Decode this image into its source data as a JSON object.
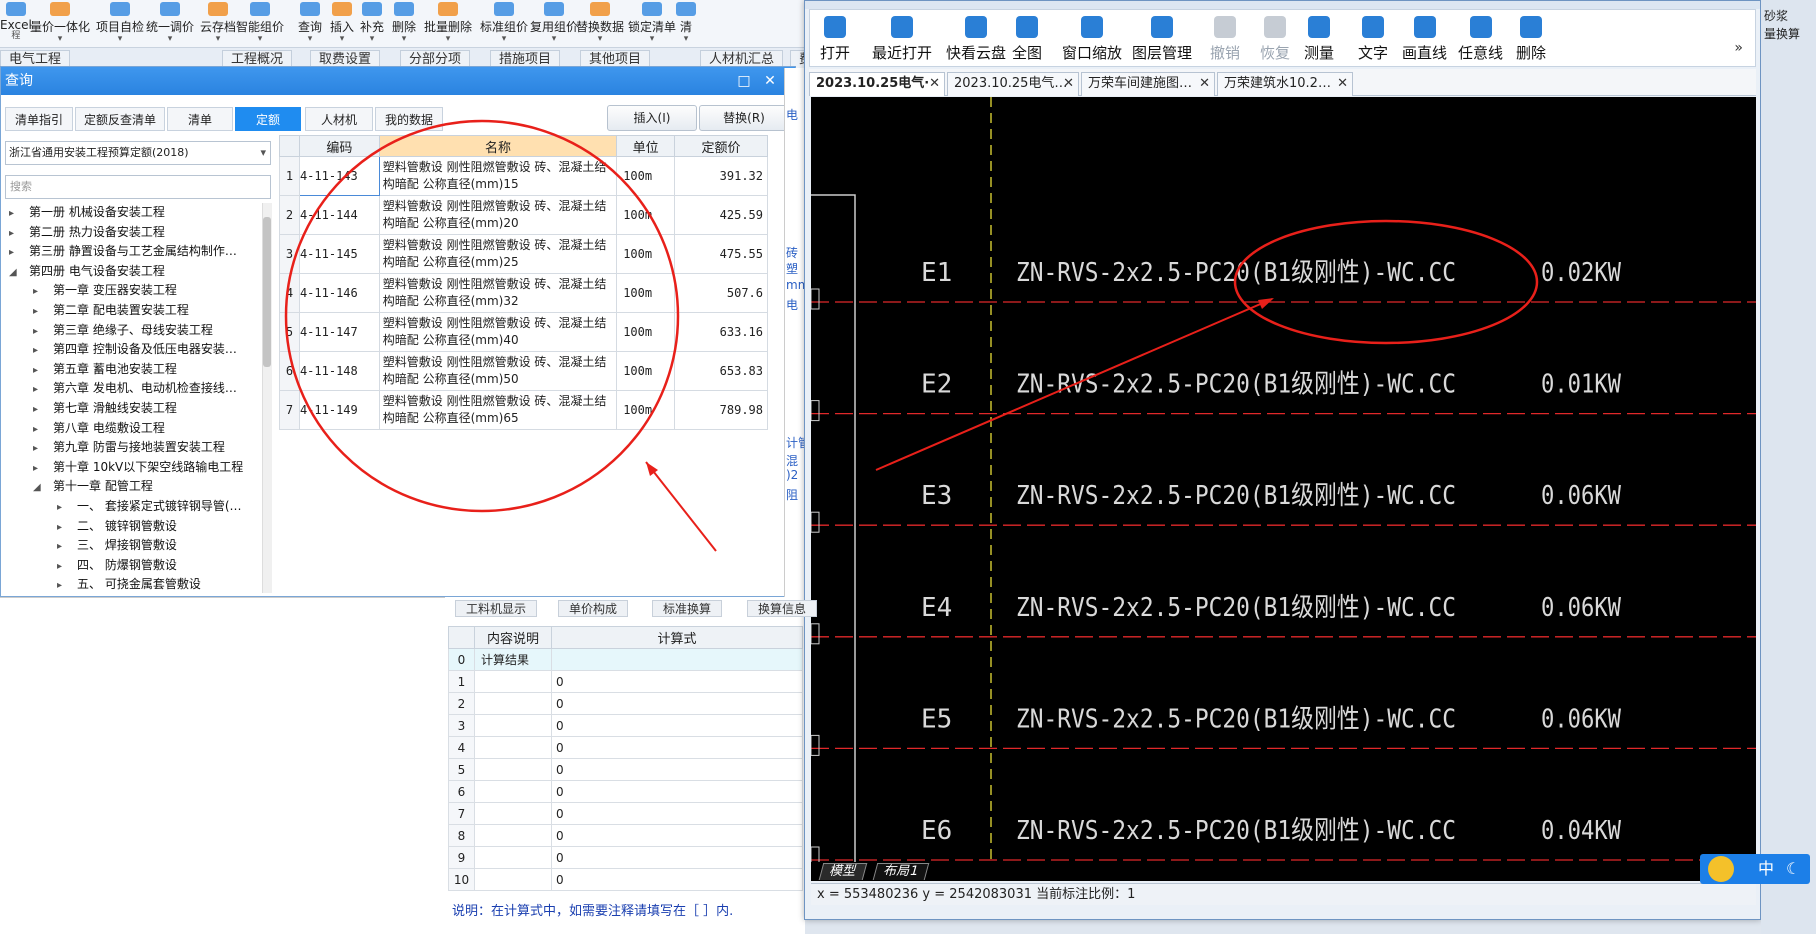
{
  "top_toolbar": {
    "items": [
      {
        "label": "Excel",
        "sub": "程",
        "icon": "excel-icon"
      },
      {
        "label": "量价一体化",
        "icon": "price-icon"
      },
      {
        "label": "项目自检",
        "icon": "check-icon"
      },
      {
        "label": "统一调价",
        "icon": "adjust-icon"
      },
      {
        "label": "云存档",
        "icon": "cloud-icon"
      },
      {
        "label": "智能组价",
        "icon": "smart-icon"
      },
      {
        "label": "查询",
        "icon": "search-icon"
      },
      {
        "label": "插入",
        "icon": "insert-icon"
      },
      {
        "label": "补充",
        "icon": "add-icon"
      },
      {
        "label": "删除",
        "icon": "delete-icon"
      },
      {
        "label": "批量删除",
        "icon": "batch-delete-icon"
      },
      {
        "label": "标准组价",
        "icon": "standard-icon"
      },
      {
        "label": "复用组价",
        "icon": "reuse-icon"
      },
      {
        "label": "替换数据",
        "icon": "replace-icon"
      },
      {
        "label": "锁定清单",
        "icon": "lock-icon"
      },
      {
        "label": "清",
        "icon": "clear-icon"
      }
    ],
    "right_labels": [
      "砂浆",
      "量换算"
    ]
  },
  "page_tabs": [
    "电气工程",
    "工程概况",
    "取费设置",
    "分部分项",
    "措施项目",
    "其他项目",
    "人材机汇总",
    "费"
  ],
  "query": {
    "title": "查询",
    "tabs": [
      "清单指引",
      "定额反查清单",
      "清单",
      "定额",
      "人材机",
      "我的数据"
    ],
    "active_tab": "定额",
    "insert_label": "插入(I)",
    "replace_label": "替换(R)",
    "library": "浙江省通用安装工程预算定额(2018)",
    "search_placeholder": "搜索",
    "tree": [
      {
        "label": "第一册 机械设备安装工程",
        "level": 0,
        "arrow": "▸"
      },
      {
        "label": "第二册 热力设备安装工程",
        "level": 0,
        "arrow": "▸"
      },
      {
        "label": "第三册 静置设备与工艺金属结构制作…",
        "level": 0,
        "arrow": "▸"
      },
      {
        "label": "第四册 电气设备安装工程",
        "level": 0,
        "arrow": "◢"
      },
      {
        "label": "第一章 变压器安装工程",
        "level": 1,
        "arrow": "▸"
      },
      {
        "label": "第二章 配电装置安装工程",
        "level": 1,
        "arrow": "▸"
      },
      {
        "label": "第三章 绝缘子、母线安装工程",
        "level": 1,
        "arrow": "▸"
      },
      {
        "label": "第四章 控制设备及低压电器安装…",
        "level": 1,
        "arrow": "▸"
      },
      {
        "label": "第五章 蓄电池安装工程",
        "level": 1,
        "arrow": "▸"
      },
      {
        "label": "第六章 发电机、电动机检查接线…",
        "level": 1,
        "arrow": "▸"
      },
      {
        "label": "第七章 滑触线安装工程",
        "level": 1,
        "arrow": "▸"
      },
      {
        "label": "第八章 电缆敷设工程",
        "level": 1,
        "arrow": "▸"
      },
      {
        "label": "第九章 防雷与接地装置安装工程",
        "level": 1,
        "arrow": "▸"
      },
      {
        "label": "第十章 10kV以下架空线路输电工程",
        "level": 1,
        "arrow": "▸"
      },
      {
        "label": "第十一章 配管工程",
        "level": 1,
        "arrow": "◢"
      },
      {
        "label": "一、 套接紧定式镀锌钢导管(…",
        "level": 2,
        "arrow": "▸"
      },
      {
        "label": "二、 镀锌钢管敷设",
        "level": 2,
        "arrow": "▸"
      },
      {
        "label": "三、 焊接钢管敷设",
        "level": 2,
        "arrow": "▸"
      },
      {
        "label": "四、 防爆钢管敷设",
        "level": 2,
        "arrow": "▸"
      },
      {
        "label": "五、 可挠金属套管敷设",
        "level": 2,
        "arrow": "▸"
      }
    ],
    "table": {
      "headers": [
        "编码",
        "名称",
        "单位",
        "定额价"
      ],
      "rows": [
        {
          "n": "1",
          "code": "4-11-143",
          "name": "塑料管敷设 刚性阻燃管敷设 砖、混凝土结构暗配 公称直径(mm)15",
          "unit": "100m",
          "price": "391.32"
        },
        {
          "n": "2",
          "code": "4-11-144",
          "name": "塑料管敷设 刚性阻燃管敷设 砖、混凝土结构暗配 公称直径(mm)20",
          "unit": "100m",
          "price": "425.59"
        },
        {
          "n": "3",
          "code": "4-11-145",
          "name": "塑料管敷设 刚性阻燃管敷设 砖、混凝土结构暗配 公称直径(mm)25",
          "unit": "100m",
          "price": "475.55"
        },
        {
          "n": "4",
          "code": "4-11-146",
          "name": "塑料管敷设 刚性阻燃管敷设 砖、混凝土结构暗配 公称直径(mm)32",
          "unit": "100m",
          "price": "507.6"
        },
        {
          "n": "5",
          "code": "4-11-147",
          "name": "塑料管敷设 刚性阻燃管敷设 砖、混凝土结构暗配 公称直径(mm)40",
          "unit": "100m",
          "price": "633.16"
        },
        {
          "n": "6",
          "code": "4-11-148",
          "name": "塑料管敷设 刚性阻燃管敷设 砖、混凝土结构暗配 公称直径(mm)50",
          "unit": "100m",
          "price": "653.83"
        },
        {
          "n": "7",
          "code": "4-11-149",
          "name": "塑料管敷设 刚性阻燃管敷设 砖、混凝土结构暗配 公称直径(mm)65",
          "unit": "100m",
          "price": "789.98"
        }
      ]
    }
  },
  "calc": {
    "tabs": [
      "工料机显示",
      "单价构成",
      "标准换算",
      "换算信息"
    ],
    "headers": [
      "内容说明",
      "计算式"
    ],
    "result_row": {
      "n": "0",
      "label": "计算结果"
    },
    "rows": [
      {
        "n": "1",
        "v": "0"
      },
      {
        "n": "2",
        "v": "0"
      },
      {
        "n": "3",
        "v": "0"
      },
      {
        "n": "4",
        "v": "0"
      },
      {
        "n": "5",
        "v": "0"
      },
      {
        "n": "6",
        "v": "0"
      },
      {
        "n": "7",
        "v": "0"
      },
      {
        "n": "8",
        "v": "0"
      },
      {
        "n": "9",
        "v": "0"
      },
      {
        "n": "10",
        "v": "0"
      }
    ],
    "hint": "说明：在计算式中，如需要注释请填写在［ ］内."
  },
  "gutter_text": [
    "电",
    "砖",
    "塑",
    "mm",
    "电",
    "计管",
    "混",
    ")2",
    "阻"
  ],
  "cad": {
    "tools": [
      {
        "label": "打开",
        "icon": "folder-open-icon",
        "enabled": true
      },
      {
        "label": "最近打开",
        "icon": "recent-icon",
        "enabled": true
      },
      {
        "label": "快看云盘",
        "icon": "cloud-drive-icon",
        "enabled": true
      },
      {
        "label": "全图",
        "icon": "fit-all-icon",
        "enabled": true
      },
      {
        "label": "窗口缩放",
        "icon": "zoom-window-icon",
        "enabled": true
      },
      {
        "label": "图层管理",
        "icon": "layers-icon",
        "enabled": true
      },
      {
        "label": "撤销",
        "icon": "undo-icon",
        "enabled": false
      },
      {
        "label": "恢复",
        "icon": "redo-icon",
        "enabled": false
      },
      {
        "label": "测量",
        "icon": "measure-icon",
        "enabled": true
      },
      {
        "label": "文字",
        "icon": "text-icon",
        "enabled": true
      },
      {
        "label": "画直线",
        "icon": "line-icon",
        "enabled": true
      },
      {
        "label": "任意线",
        "icon": "freehand-icon",
        "enabled": true
      },
      {
        "label": "删除",
        "icon": "eraser-icon",
        "enabled": true
      }
    ],
    "more": "»",
    "doc_tabs": [
      "2023.10.25电气·",
      "2023.10.25电气…",
      "万荣车间建施图…",
      "万荣建筑水10.2…"
    ],
    "circuits": [
      {
        "id": "E1",
        "spec": "ZN-RVS-2x2.5-PC20(B1级刚性)-WC.CC",
        "power": "0.02KW"
      },
      {
        "id": "E2",
        "spec": "ZN-RVS-2x2.5-PC20(B1级刚性)-WC.CC",
        "power": "0.01KW"
      },
      {
        "id": "E3",
        "spec": "ZN-RVS-2x2.5-PC20(B1级刚性)-WC.CC",
        "power": "0.06KW"
      },
      {
        "id": "E4",
        "spec": "ZN-RVS-2x2.5-PC20(B1级刚性)-WC.CC",
        "power": "0.06KW"
      },
      {
        "id": "E5",
        "spec": "ZN-RVS-2x2.5-PC20(B1级刚性)-WC.CC",
        "power": "0.06KW"
      },
      {
        "id": "E6",
        "spec": "ZN-RVS-2x2.5-PC20(B1级刚性)-WC.CC",
        "power": "0.04KW"
      }
    ],
    "layout_tabs": [
      "模型",
      "布局1"
    ],
    "status": "x = 553480236  y = 2542083031  当前标注比例：1"
  },
  "ime": {
    "label": "中",
    "moon": "☾"
  },
  "colors": {
    "accent": "#2a83e0",
    "annotation": "#e8201a",
    "cad_text": "#d9d9d9",
    "cad_line": "#e0282a"
  }
}
